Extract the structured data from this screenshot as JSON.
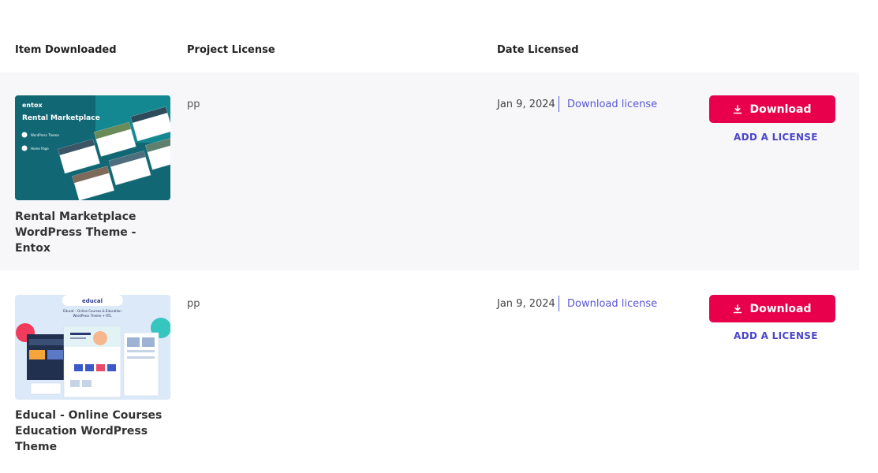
{
  "columns": {
    "item": "Item Downloaded",
    "license": "Project License",
    "date": "Date Licensed"
  },
  "rows": [
    {
      "title": "Rental Marketplace WordPress Theme - Entox",
      "license": "pp",
      "date": "Jan 9, 2024",
      "download_license_label": "Download license",
      "download_label": "Download",
      "add_license_label": "ADD A LICENSE",
      "thumb": {
        "brand": "entox",
        "headline": "Rental Marketplace",
        "caption1": "WordPress Theme",
        "caption2": "Home Page"
      }
    },
    {
      "title": "Educal - Online Courses Education WordPress Theme",
      "license": "pp",
      "date": "Jan 9, 2024",
      "download_license_label": "Download license",
      "download_label": "Download",
      "add_license_label": "ADD A LICENSE",
      "thumb": {
        "brand": "educal",
        "headline": "Educal – Online Courses & Education",
        "caption1": "WordPress Theme + RTL"
      }
    }
  ],
  "colors": {
    "accent": "#e8004d",
    "link": "#5b57d6",
    "row_bg": "#f7f7fa"
  },
  "icons": {
    "download_button": "download-icon"
  }
}
